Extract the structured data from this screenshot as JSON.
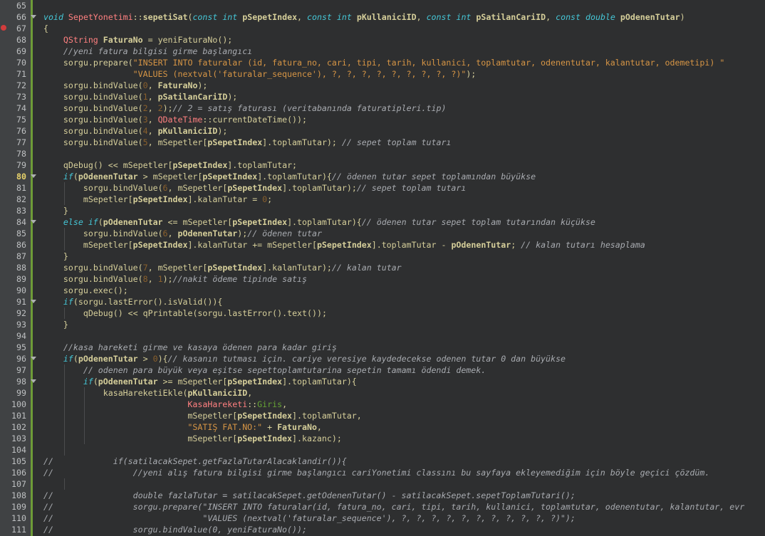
{
  "editor": {
    "current_line": 80,
    "breakpoint_line": 67,
    "fold_lines": [
      66,
      80,
      84,
      91,
      96,
      98
    ]
  },
  "lines": [
    {
      "n": 65,
      "indent": 0,
      "t": ""
    },
    {
      "n": 66,
      "indent": 0,
      "t": "void SepetYonetimi::sepetiSat(const int pSepetIndex, const int pKullaniciID, const int pSatilanCariID, const double pOdenenTutar)"
    },
    {
      "n": 67,
      "indent": 0,
      "t": "{"
    },
    {
      "n": 68,
      "indent": 1,
      "t": "QString FaturaNo = yeniFaturaNo();"
    },
    {
      "n": 69,
      "indent": 1,
      "t": "//yeni fatura bilgisi girme başlangıcı"
    },
    {
      "n": 70,
      "indent": 1,
      "t": "sorgu.prepare(\"INSERT INTO faturalar (id, fatura_no, cari, tipi, tarih, kullanici, toplamtutar, odenentutar, kalantutar, odemetipi) \""
    },
    {
      "n": 71,
      "indent": 1,
      "t": "              \"VALUES (nextval('faturalar_sequence'), ?, ?, ?, ?, ?, ?, ?, ?, ?)\");"
    },
    {
      "n": 72,
      "indent": 1,
      "t": "sorgu.bindValue(0, FaturaNo);"
    },
    {
      "n": 73,
      "indent": 1,
      "t": "sorgu.bindValue(1, pSatilanCariID);"
    },
    {
      "n": 74,
      "indent": 1,
      "t": "sorgu.bindValue(2, 2);// 2 = satış faturası (veritabanında faturatipleri.tip)"
    },
    {
      "n": 75,
      "indent": 1,
      "t": "sorgu.bindValue(3, QDateTime::currentDateTime());"
    },
    {
      "n": 76,
      "indent": 1,
      "t": "sorgu.bindValue(4, pKullaniciID);"
    },
    {
      "n": 77,
      "indent": 1,
      "t": "sorgu.bindValue(5, mSepetler[pSepetIndex].toplamTutar); // sepet toplam tutarı"
    },
    {
      "n": 78,
      "indent": 1,
      "t": ""
    },
    {
      "n": 79,
      "indent": 1,
      "t": "qDebug() << mSepetler[pSepetIndex].toplamTutar;"
    },
    {
      "n": 80,
      "indent": 1,
      "t": "if(pOdenenTutar > mSepetler[pSepetIndex].toplamTutar){// ödenen tutar sepet toplamından büyükse"
    },
    {
      "n": 81,
      "indent": 2,
      "t": "sorgu.bindValue(6, mSepetler[pSepetIndex].toplamTutar);// sepet toplam tutarı"
    },
    {
      "n": 82,
      "indent": 2,
      "t": "mSepetler[pSepetIndex].kalanTutar = 0;"
    },
    {
      "n": 83,
      "indent": 1,
      "t": "}"
    },
    {
      "n": 84,
      "indent": 1,
      "t": "else if(pOdenenTutar <= mSepetler[pSepetIndex].toplamTutar){// ödenen tutar sepet toplam tutarından küçükse"
    },
    {
      "n": 85,
      "indent": 2,
      "t": "sorgu.bindValue(6, pOdenenTutar);// ödenen tutar"
    },
    {
      "n": 86,
      "indent": 2,
      "t": "mSepetler[pSepetIndex].kalanTutar += mSepetler[pSepetIndex].toplamTutar - pOdenenTutar; // kalan tutarı hesaplama"
    },
    {
      "n": 87,
      "indent": 1,
      "t": "}"
    },
    {
      "n": 88,
      "indent": 1,
      "t": "sorgu.bindValue(7, mSepetler[pSepetIndex].kalanTutar);// kalan tutar"
    },
    {
      "n": 89,
      "indent": 1,
      "t": "sorgu.bindValue(8, 1);//nakit ödeme tipinde satış"
    },
    {
      "n": 90,
      "indent": 1,
      "t": "sorgu.exec();"
    },
    {
      "n": 91,
      "indent": 1,
      "t": "if(sorgu.lastError().isValid()){"
    },
    {
      "n": 92,
      "indent": 2,
      "t": "qDebug() << qPrintable(sorgu.lastError().text());"
    },
    {
      "n": 93,
      "indent": 1,
      "t": "}"
    },
    {
      "n": 94,
      "indent": 1,
      "t": ""
    },
    {
      "n": 95,
      "indent": 1,
      "t": "//kasa hareketi girme ve kasaya ödenen para kadar giriş"
    },
    {
      "n": 96,
      "indent": 1,
      "t": "if(pOdenenTutar > 0){// kasanın tutması için. cariye veresiye kaydedecekse odenen tutar 0 dan büyükse"
    },
    {
      "n": 97,
      "indent": 2,
      "t": "// odenen para büyük veya eşitse sepettoplamtutarina sepetin tamamı ödendi demek."
    },
    {
      "n": 98,
      "indent": 2,
      "t": "if(pOdenenTutar >= mSepetler[pSepetIndex].toplamTutar){"
    },
    {
      "n": 99,
      "indent": 3,
      "t": "kasaHareketiEkle(pKullaniciID,"
    },
    {
      "n": 100,
      "indent": 3,
      "t": "                 KasaHareketi::Giris,"
    },
    {
      "n": 101,
      "indent": 3,
      "t": "                 mSepetler[pSepetIndex].toplamTutar,"
    },
    {
      "n": 102,
      "indent": 3,
      "t": "                 \"SATIŞ FAT.NO:\" + FaturaNo,"
    },
    {
      "n": 103,
      "indent": 3,
      "t": "                 mSepetler[pSepetIndex].kazanc);"
    },
    {
      "n": 104,
      "indent": 2,
      "t": ""
    },
    {
      "n": 105,
      "indent": 0,
      "t": "//            if(satilacakSepet.getFazlaTutarAlacaklandir()){"
    },
    {
      "n": 106,
      "indent": 0,
      "t": "//                //yeni alış fatura bilgisi girme başlangıcı cariYonetimi classını bu sayfaya ekleyemediğim için böyle geçici çözdüm."
    },
    {
      "n": 107,
      "indent": 2,
      "t": ""
    },
    {
      "n": 108,
      "indent": 0,
      "t": "//                double fazlaTutar = satilacakSepet.getOdenenTutar() - satilacakSepet.sepetToplamTutari();"
    },
    {
      "n": 109,
      "indent": 0,
      "t": "//                sorgu.prepare(\"INSERT INTO faturalar(id, fatura_no, cari, tipi, tarih, kullanici, toplamtutar, odenentutar, kalantutar, evr"
    },
    {
      "n": 110,
      "indent": 0,
      "t": "//                              \"VALUES (nextval('faturalar_sequence'), ?, ?, ?, ?, ?, ?, ?, ?, ?, ?, ?)\");"
    },
    {
      "n": 111,
      "indent": 0,
      "t": "//                sorgu.bindValue(0, yeniFaturaNo());"
    }
  ]
}
